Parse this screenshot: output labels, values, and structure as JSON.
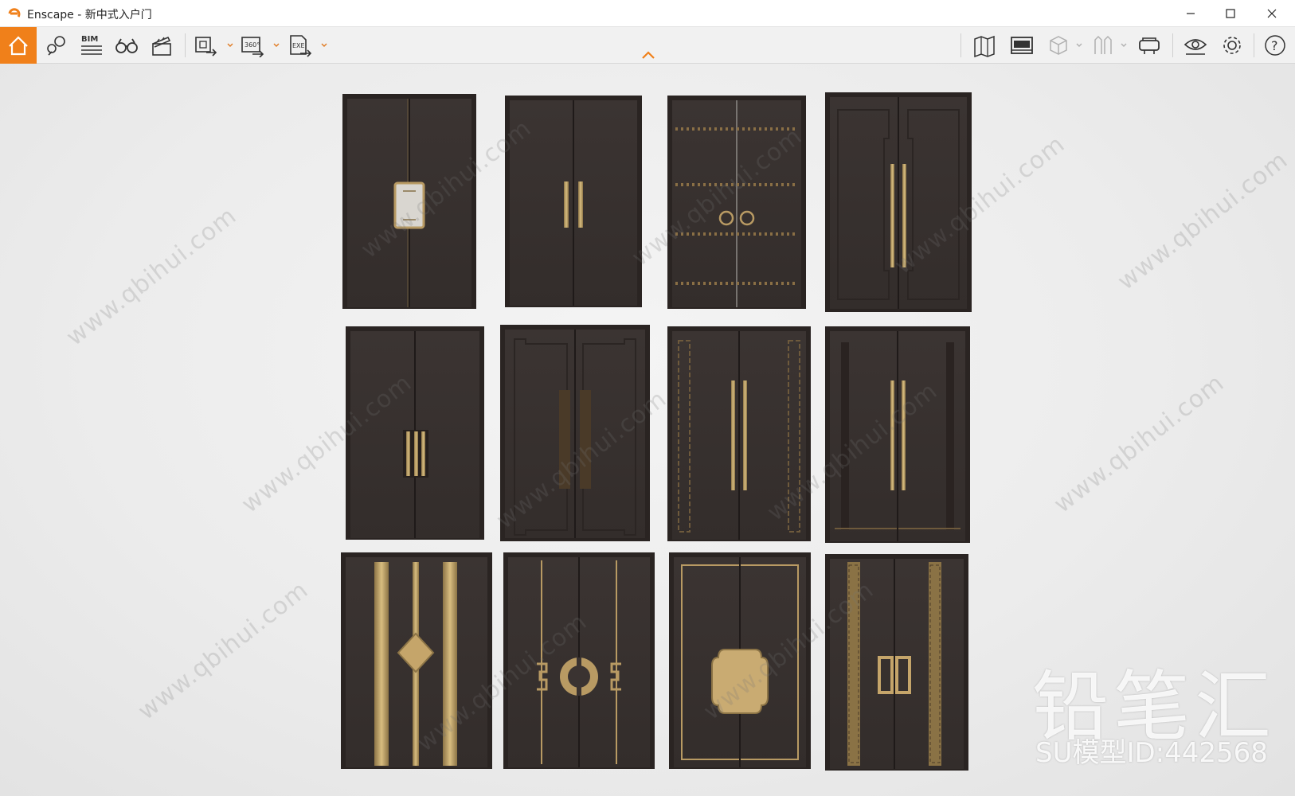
{
  "window": {
    "app_name": "Enscape",
    "title": "Enscape - 新中式入户门"
  },
  "colors": {
    "accent": "#f0801a",
    "door_body": "#3a3331",
    "door_frame": "#2a2422",
    "brass": "#b89a63"
  },
  "toolbar": {
    "home": {
      "icon": "home-icon",
      "label": "Home"
    },
    "left_tools": [
      {
        "icon": "views-icon"
      },
      {
        "icon": "bim-icon",
        "text": "BIM"
      },
      {
        "icon": "binoculars-icon"
      },
      {
        "icon": "clapperboard-icon"
      },
      {
        "icon": "screenshot-export-icon"
      },
      {
        "icon": "panorama-360-icon",
        "text": "360°"
      },
      {
        "icon": "exe-export-icon",
        "text": "EXE"
      }
    ],
    "right_tools": [
      {
        "icon": "map-icon"
      },
      {
        "icon": "asset-library-icon"
      },
      {
        "icon": "cube-icon"
      },
      {
        "icon": "books-icon"
      },
      {
        "icon": "vr-headset-icon"
      },
      {
        "icon": "eye-icon"
      },
      {
        "icon": "gear-icon"
      },
      {
        "icon": "help-icon",
        "text": "?"
      }
    ]
  },
  "watermark": {
    "site": "www.qbihui.com",
    "brand": "铅笔汇",
    "model_id": "SU模型ID:442568"
  }
}
